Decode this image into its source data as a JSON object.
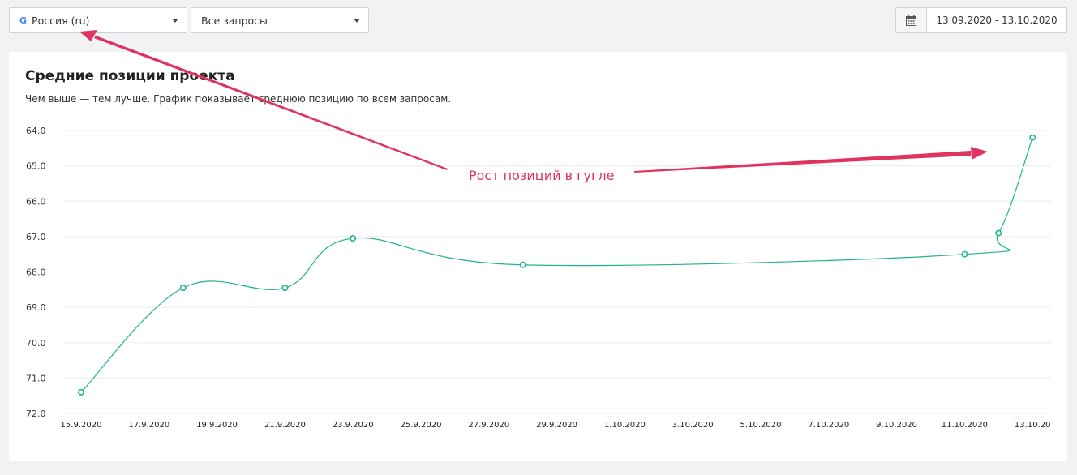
{
  "filters": {
    "region": {
      "label": "Россия (ru)",
      "icon": "google-g-icon"
    },
    "queries": {
      "label": "Все запросы"
    }
  },
  "date_range": {
    "icon": "calendar-icon",
    "value": "13.09.2020 - 13.10.2020"
  },
  "card": {
    "title": "Средние позиции проекта",
    "subtitle": "Чем выше — тем лучше. График показывает среднюю позицию по всем запросам."
  },
  "annotation": {
    "text": "Рост позиций в гугле",
    "color": "#e0335f"
  },
  "colors": {
    "line": "#20b48e",
    "arrow": "#e0335f",
    "grid": "#ececec"
  },
  "chart_data": {
    "type": "line",
    "title": "Средние позиции проекта",
    "y_inverted": true,
    "ylim": [
      64.0,
      72.0
    ],
    "y_ticks": [
      "64.0",
      "65.0",
      "66.0",
      "67.0",
      "68.0",
      "69.0",
      "70.0",
      "71.0",
      "72.0"
    ],
    "x_ticks": [
      "15.9.2020",
      "17.9.2020",
      "19.9.2020",
      "21.9.2020",
      "23.9.2020",
      "25.9.2020",
      "27.9.2020",
      "29.9.2020",
      "1.10.2020",
      "3.10.2020",
      "5.10.2020",
      "7.10.2020",
      "9.10.2020",
      "11.10.2020",
      "13.10.20"
    ],
    "xlim": [
      "2020-09-15",
      "2020-10-13"
    ],
    "grid": true,
    "series": [
      {
        "points": [
          {
            "x": "2020-09-15",
            "y": 71.4
          },
          {
            "x": "2020-09-18",
            "y": 68.45
          },
          {
            "x": "2020-09-21",
            "y": 68.45
          },
          {
            "x": "2020-09-23",
            "y": 67.05
          },
          {
            "x": "2020-09-28",
            "y": 67.8
          },
          {
            "x": "2020-10-11",
            "y": 67.5
          },
          {
            "x": "2020-10-12",
            "y": 66.9
          },
          {
            "x": "2020-10-13",
            "y": 64.2
          }
        ]
      }
    ]
  }
}
